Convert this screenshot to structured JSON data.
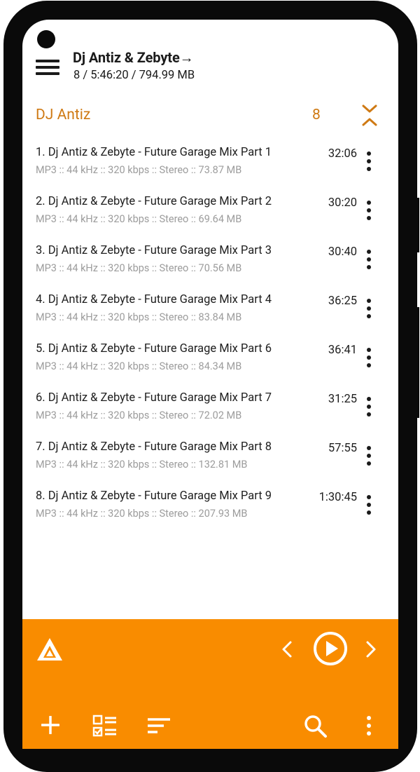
{
  "header": {
    "title": "Dj Antiz & Zebyte→",
    "subtitle": "8 / 5:46:20 / 794.99 MB"
  },
  "group": {
    "name": "DJ Antiz",
    "count": "8"
  },
  "tracks": [
    {
      "title": "1. Dj Antiz & Zebyte - Future Garage Mix Part 1",
      "info": "MP3 :: 44 kHz :: 320 kbps :: Stereo :: 73.87 MB",
      "duration": "32:06"
    },
    {
      "title": "2. Dj Antiz & Zebyte - Future Garage Mix Part 2",
      "info": "MP3 :: 44 kHz :: 320 kbps :: Stereo :: 69.64 MB",
      "duration": "30:20"
    },
    {
      "title": "3. Dj Antiz & Zebyte - Future Garage Mix Part 3",
      "info": "MP3 :: 44 kHz :: 320 kbps :: Stereo :: 70.56 MB",
      "duration": "30:40"
    },
    {
      "title": "4. Dj Antiz & Zebyte - Future Garage Mix Part 4",
      "info": "MP3 :: 44 kHz :: 320 kbps :: Stereo :: 83.84 MB",
      "duration": "36:25"
    },
    {
      "title": "5. Dj Antiz & Zebyte - Future Garage Mix Part 6",
      "info": "MP3 :: 44 kHz :: 320 kbps :: Stereo :: 84.34 MB",
      "duration": "36:41"
    },
    {
      "title": "6. Dj Antiz & Zebyte - Future Garage Mix Part 7",
      "info": "MP3 :: 44 kHz :: 320 kbps :: Stereo :: 72.02 MB",
      "duration": "31:25"
    },
    {
      "title": "7. Dj Antiz & Zebyte - Future Garage Mix Part 8",
      "info": "MP3 :: 44 kHz :: 320 kbps :: Stereo :: 132.81 MB",
      "duration": "57:55"
    },
    {
      "title": "8. Dj Antiz & Zebyte - Future Garage Mix Part 9",
      "info": "MP3 :: 44 kHz :: 320 kbps :: Stereo :: 207.93 MB",
      "duration": "1:30:45"
    }
  ],
  "colors": {
    "accent": "#f98c00",
    "group_text": "#cf7a14",
    "frame": "#0a0a0a"
  },
  "icons": {
    "menu": "hamburger-menu-icon",
    "collapse": "collapse-chevrons-icon",
    "track_more": "more-vertical-icon",
    "app_logo": "aimp-logo-icon",
    "prev": "chevron-left-icon",
    "play": "play-circle-icon",
    "next": "chevron-right-icon",
    "add": "plus-icon",
    "select": "checklist-icon",
    "sort": "sort-icon",
    "search": "search-icon",
    "more": "more-vertical-icon"
  }
}
